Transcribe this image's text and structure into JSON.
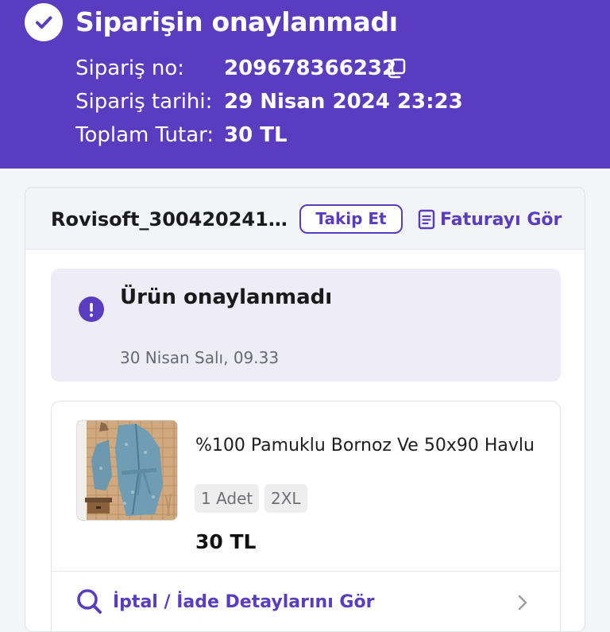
{
  "header": {
    "title": "Siparişin onaylanmadı",
    "status_icon": "check-circle-icon",
    "order_no_label": "Sipariş no:",
    "order_no_value": "209678366232",
    "order_date_label": "Sipariş tarihi:",
    "order_date_value": "29 Nisan 2024 23:23",
    "total_label": "Toplam Tutar:",
    "total_value": "30 TL"
  },
  "seller": {
    "name": "Rovisoft_3004202410...",
    "track_label": "Takip Et",
    "invoice_label": "Faturayı Gör"
  },
  "status": {
    "title": "Ürün onaylanmadı",
    "date": "30 Nisan Salı, 09.33",
    "icon": "exclamation-circle-icon"
  },
  "product": {
    "name": "%100 Pamuklu Bornoz Ve 50x90 Havlu",
    "quantity": "1 Adet",
    "size": "2XL",
    "price": "30 TL"
  },
  "actions": {
    "refund_details_label": "İptal / İade Detaylarını Gör"
  },
  "colors": {
    "primary": "#5a3cc0",
    "status_background": "#eeedf7",
    "page_background": "#f4f5f7"
  }
}
